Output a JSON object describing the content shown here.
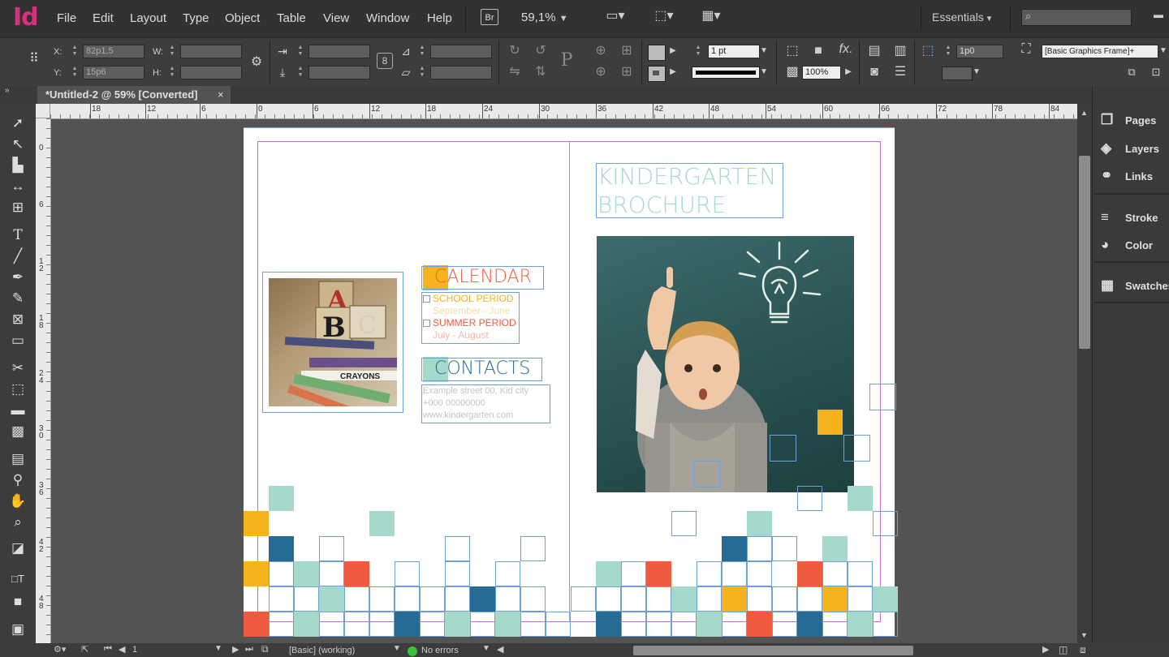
{
  "app": {
    "logo": "Id"
  },
  "menu": {
    "items": [
      "File",
      "Edit",
      "Layout",
      "Type",
      "Object",
      "Table",
      "View",
      "Window",
      "Help"
    ]
  },
  "appbar": {
    "bridge_label": "Br",
    "zoom": "59,1%",
    "workspace": "Essentials"
  },
  "control": {
    "x_label": "X:",
    "x_value": "82p1,5",
    "y_label": "Y:",
    "y_value": "15p6",
    "w_label": "W:",
    "h_label": "H:",
    "stroke_weight": "1 pt",
    "opacity": "100%",
    "offset": "1p0",
    "object_style": "[Basic Graphics Frame]+"
  },
  "tab": {
    "title": "*Untitled-2 @ 59% [Converted]",
    "close": "×"
  },
  "ruler": {
    "h_ticks": [
      "18",
      "12",
      "6",
      "0",
      "6",
      "12",
      "18",
      "24",
      "30",
      "36",
      "42",
      "48",
      "54",
      "60",
      "66",
      "72",
      "78",
      "84"
    ],
    "v_ticks": [
      "0",
      "6",
      "1 2",
      "1 8",
      "2 4",
      "3 0",
      "3 6",
      "4 2",
      "4 8"
    ]
  },
  "panels": {
    "items": [
      {
        "label": "Pages",
        "icon": "pages-icon"
      },
      {
        "label": "Layers",
        "icon": "layers-icon"
      },
      {
        "label": "Links",
        "icon": "links-icon"
      },
      {
        "label": "Stroke",
        "icon": "stroke-icon"
      },
      {
        "label": "Color",
        "icon": "color-icon"
      },
      {
        "label": "Swatches",
        "icon": "swatches-icon"
      }
    ]
  },
  "status": {
    "page": "1",
    "style": "[Basic] (working)",
    "preflight": "No errors"
  },
  "document": {
    "title_line1": "KINDERGARTEN",
    "title_line2": "BROCHURE",
    "calendar_heading": "CALENDAR",
    "school_period": "SCHOOL PERIOD",
    "school_dates": "September - June",
    "summer_period": "SUMMER PERIOD",
    "summer_dates": "July - August",
    "contacts_heading": "CONTACTS",
    "address": "Example street 00, Kid city",
    "phone": "+000 00000000",
    "website": "www.kindergarten.com",
    "colors": {
      "teal": "#a5d9cb",
      "yellow": "#f6b31d",
      "red": "#ef5b3f",
      "navy": "#256b94",
      "title": "#a5d9cb",
      "calendar": "#ef5b3f",
      "contacts": "#256b94"
    }
  }
}
